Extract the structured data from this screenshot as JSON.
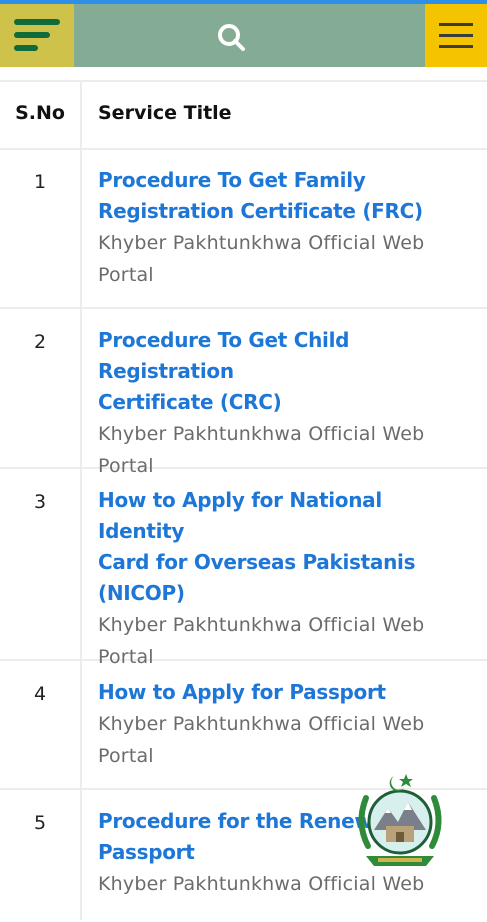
{
  "header": {
    "logo_icon": "menu-logo-icon",
    "search_icon": "search-icon",
    "menu_icon": "hamburger-menu-icon"
  },
  "table": {
    "headers": [
      "S.No",
      "Service Title"
    ],
    "rows": [
      {
        "sno": "1",
        "title_lines": [
          "Procedure To Get Family",
          "Registration Certificate (FRC)"
        ],
        "subtitle_lines": [
          "Khyber Pakhtunkhwa Official Web",
          "Portal"
        ]
      },
      {
        "sno": "2",
        "title_lines": [
          "Procedure To Get Child Registration",
          "Certificate (CRC)"
        ],
        "subtitle_lines": [
          "Khyber Pakhtunkhwa Official Web",
          "Portal"
        ]
      },
      {
        "sno": "3",
        "title_lines": [
          "How to Apply for National Identity",
          "Card for Overseas Pakistanis",
          "(NICOP)"
        ],
        "subtitle_lines": [
          "Khyber Pakhtunkhwa Official Web",
          "Portal"
        ]
      },
      {
        "sno": "4",
        "title_lines": [
          "How to Apply for Passport"
        ],
        "subtitle_lines": [
          "Khyber Pakhtunkhwa Official Web",
          "Portal"
        ]
      },
      {
        "sno": "5",
        "title_lines": [
          "Procedure for the Renewal",
          "Passport"
        ],
        "subtitle_lines": [
          "Khyber Pakhtunkhwa Official Web"
        ]
      }
    ]
  },
  "colors": {
    "header_bg": "#84ab93",
    "logo_bg": "#cfc24a",
    "menu_bg": "#f5c400",
    "link": "#1e77d6"
  },
  "floating": {
    "emblem_icon": "kp-emblem-icon"
  }
}
